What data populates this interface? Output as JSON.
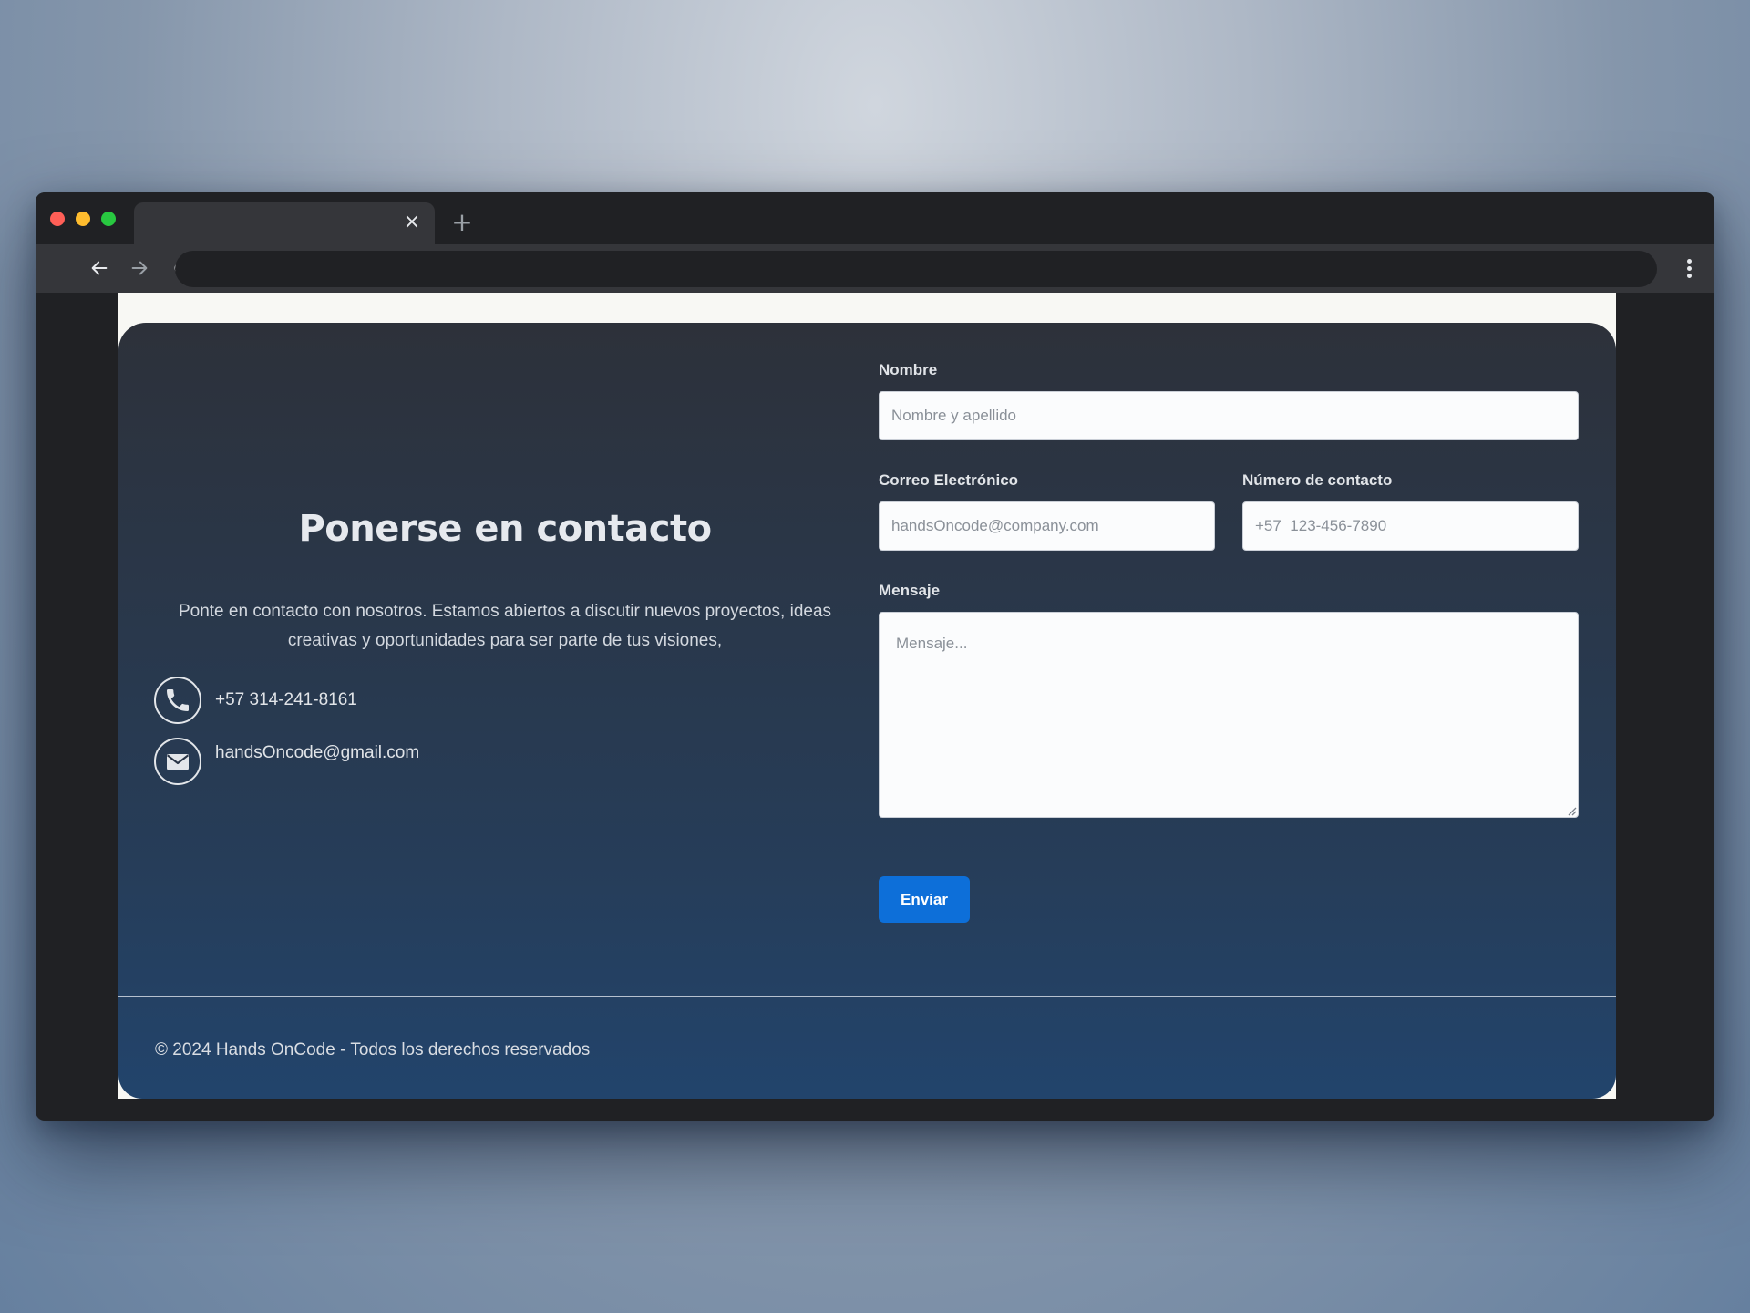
{
  "browser": {
    "tab": {
      "title": "",
      "close_glyph": "×"
    },
    "new_tab_glyph": "+",
    "address": ""
  },
  "contact": {
    "heading": "Ponerse en contacto",
    "description": "Ponte en contacto con nosotros. Estamos abiertos a discutir nuevos proyectos, ideas creativas y oportunidades para ser parte de tus visiones,",
    "phone": "+57 314-241-8161",
    "email": "handsOncode@gmail.com",
    "icons": {
      "phone": "phone-icon",
      "email": "envelope-icon"
    }
  },
  "form": {
    "name": {
      "label": "Nombre",
      "placeholder": "Nombre y apellido"
    },
    "email": {
      "label": "Correo Electrónico",
      "placeholder": "handsOncode@company.com"
    },
    "phone": {
      "label": "Número de contacto",
      "placeholder": "+57  123-456-7890"
    },
    "message": {
      "label": "Mensaje",
      "placeholder": "Mensaje..."
    },
    "submit_label": "Enviar"
  },
  "footer": {
    "copyright": "© 2024 Hands OnCode - Todos los derechos reservados"
  },
  "colors": {
    "accent": "#0d6fd9",
    "card_top": "#2d313a",
    "card_bottom": "#22446c",
    "page_bg": "#f8f8f4"
  }
}
